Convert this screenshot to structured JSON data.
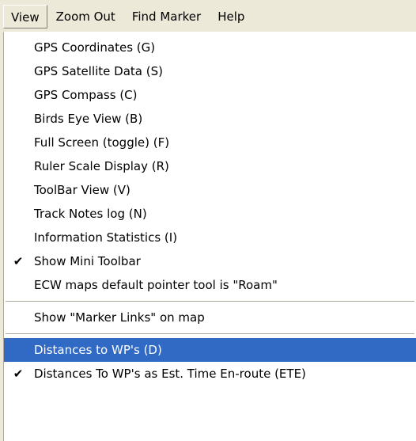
{
  "menubar": {
    "items": [
      {
        "label": "View",
        "open": true
      },
      {
        "label": "Zoom Out"
      },
      {
        "label": "Find Marker"
      },
      {
        "label": "Help"
      }
    ]
  },
  "dropdown": {
    "items": [
      {
        "label": "GPS Coordinates (G)"
      },
      {
        "label": "GPS Satellite Data (S)"
      },
      {
        "label": "GPS Compass (C)"
      },
      {
        "label": "Birds Eye View (B)"
      },
      {
        "label": "Full Screen (toggle) (F)"
      },
      {
        "label": "Ruler Scale Display (R)"
      },
      {
        "label": "ToolBar View (V)"
      },
      {
        "label": "Track Notes log (N)"
      },
      {
        "label": "Information Statistics (I)"
      },
      {
        "label": "Show Mini Toolbar",
        "checked": true,
        "check_glyph": "✔"
      },
      {
        "label": "ECW maps default pointer tool is \"Roam\""
      },
      {
        "label": "Show \"Marker Links\" on map"
      },
      {
        "label": "Distances to WP's (D)",
        "highlighted": true
      },
      {
        "label": "Distances To WP's as Est. Time En-route (ETE)",
        "checked": true,
        "check_glyph": "✔"
      }
    ]
  },
  "colors": {
    "menu_background": "#ece9d8",
    "dropdown_background": "#ffffff",
    "highlight": "#316ac5",
    "highlight_text": "#ffffff"
  }
}
